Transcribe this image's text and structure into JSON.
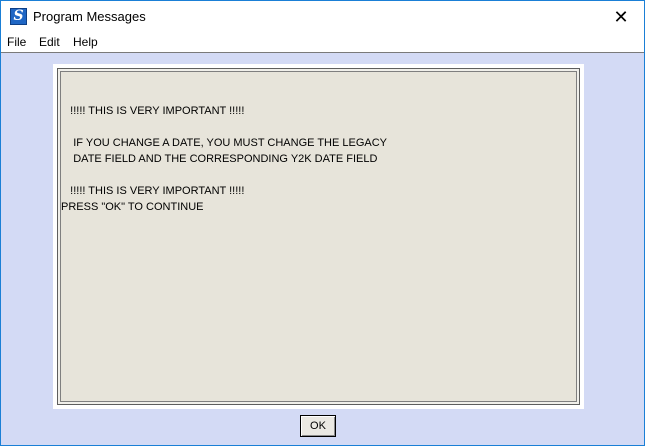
{
  "window": {
    "title": "Program Messages",
    "icon": "app-logo-icon",
    "icon_letter": "S",
    "close_glyph": "✕"
  },
  "menu": {
    "items": [
      {
        "label": "File"
      },
      {
        "label": "Edit"
      },
      {
        "label": "Help"
      }
    ]
  },
  "message": {
    "lines": [
      "   !!!!! THIS IS VERY IMPORTANT !!!!!",
      "",
      "    IF YOU CHANGE A DATE, YOU MUST CHANGE THE LEGACY",
      "    DATE FIELD AND THE CORRESPONDING Y2K DATE FIELD",
      "",
      "   !!!!! THIS IS VERY IMPORTANT !!!!!",
      "PRESS \"OK\" TO CONTINUE"
    ]
  },
  "buttons": {
    "ok_label": "OK"
  }
}
